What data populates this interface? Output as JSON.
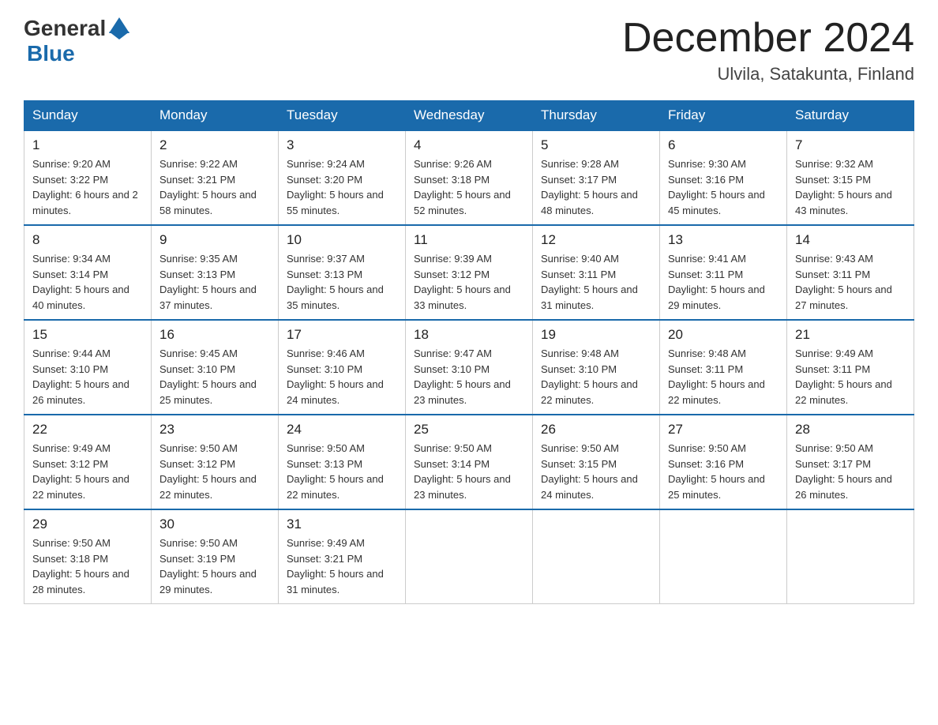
{
  "header": {
    "logo": {
      "general": "General",
      "blue": "Blue"
    },
    "title": "December 2024",
    "location": "Ulvila, Satakunta, Finland"
  },
  "calendar": {
    "days_of_week": [
      "Sunday",
      "Monday",
      "Tuesday",
      "Wednesday",
      "Thursday",
      "Friday",
      "Saturday"
    ],
    "weeks": [
      [
        {
          "day": "1",
          "sunrise": "Sunrise: 9:20 AM",
          "sunset": "Sunset: 3:22 PM",
          "daylight": "Daylight: 6 hours and 2 minutes."
        },
        {
          "day": "2",
          "sunrise": "Sunrise: 9:22 AM",
          "sunset": "Sunset: 3:21 PM",
          "daylight": "Daylight: 5 hours and 58 minutes."
        },
        {
          "day": "3",
          "sunrise": "Sunrise: 9:24 AM",
          "sunset": "Sunset: 3:20 PM",
          "daylight": "Daylight: 5 hours and 55 minutes."
        },
        {
          "day": "4",
          "sunrise": "Sunrise: 9:26 AM",
          "sunset": "Sunset: 3:18 PM",
          "daylight": "Daylight: 5 hours and 52 minutes."
        },
        {
          "day": "5",
          "sunrise": "Sunrise: 9:28 AM",
          "sunset": "Sunset: 3:17 PM",
          "daylight": "Daylight: 5 hours and 48 minutes."
        },
        {
          "day": "6",
          "sunrise": "Sunrise: 9:30 AM",
          "sunset": "Sunset: 3:16 PM",
          "daylight": "Daylight: 5 hours and 45 minutes."
        },
        {
          "day": "7",
          "sunrise": "Sunrise: 9:32 AM",
          "sunset": "Sunset: 3:15 PM",
          "daylight": "Daylight: 5 hours and 43 minutes."
        }
      ],
      [
        {
          "day": "8",
          "sunrise": "Sunrise: 9:34 AM",
          "sunset": "Sunset: 3:14 PM",
          "daylight": "Daylight: 5 hours and 40 minutes."
        },
        {
          "day": "9",
          "sunrise": "Sunrise: 9:35 AM",
          "sunset": "Sunset: 3:13 PM",
          "daylight": "Daylight: 5 hours and 37 minutes."
        },
        {
          "day": "10",
          "sunrise": "Sunrise: 9:37 AM",
          "sunset": "Sunset: 3:13 PM",
          "daylight": "Daylight: 5 hours and 35 minutes."
        },
        {
          "day": "11",
          "sunrise": "Sunrise: 9:39 AM",
          "sunset": "Sunset: 3:12 PM",
          "daylight": "Daylight: 5 hours and 33 minutes."
        },
        {
          "day": "12",
          "sunrise": "Sunrise: 9:40 AM",
          "sunset": "Sunset: 3:11 PM",
          "daylight": "Daylight: 5 hours and 31 minutes."
        },
        {
          "day": "13",
          "sunrise": "Sunrise: 9:41 AM",
          "sunset": "Sunset: 3:11 PM",
          "daylight": "Daylight: 5 hours and 29 minutes."
        },
        {
          "day": "14",
          "sunrise": "Sunrise: 9:43 AM",
          "sunset": "Sunset: 3:11 PM",
          "daylight": "Daylight: 5 hours and 27 minutes."
        }
      ],
      [
        {
          "day": "15",
          "sunrise": "Sunrise: 9:44 AM",
          "sunset": "Sunset: 3:10 PM",
          "daylight": "Daylight: 5 hours and 26 minutes."
        },
        {
          "day": "16",
          "sunrise": "Sunrise: 9:45 AM",
          "sunset": "Sunset: 3:10 PM",
          "daylight": "Daylight: 5 hours and 25 minutes."
        },
        {
          "day": "17",
          "sunrise": "Sunrise: 9:46 AM",
          "sunset": "Sunset: 3:10 PM",
          "daylight": "Daylight: 5 hours and 24 minutes."
        },
        {
          "day": "18",
          "sunrise": "Sunrise: 9:47 AM",
          "sunset": "Sunset: 3:10 PM",
          "daylight": "Daylight: 5 hours and 23 minutes."
        },
        {
          "day": "19",
          "sunrise": "Sunrise: 9:48 AM",
          "sunset": "Sunset: 3:10 PM",
          "daylight": "Daylight: 5 hours and 22 minutes."
        },
        {
          "day": "20",
          "sunrise": "Sunrise: 9:48 AM",
          "sunset": "Sunset: 3:11 PM",
          "daylight": "Daylight: 5 hours and 22 minutes."
        },
        {
          "day": "21",
          "sunrise": "Sunrise: 9:49 AM",
          "sunset": "Sunset: 3:11 PM",
          "daylight": "Daylight: 5 hours and 22 minutes."
        }
      ],
      [
        {
          "day": "22",
          "sunrise": "Sunrise: 9:49 AM",
          "sunset": "Sunset: 3:12 PM",
          "daylight": "Daylight: 5 hours and 22 minutes."
        },
        {
          "day": "23",
          "sunrise": "Sunrise: 9:50 AM",
          "sunset": "Sunset: 3:12 PM",
          "daylight": "Daylight: 5 hours and 22 minutes."
        },
        {
          "day": "24",
          "sunrise": "Sunrise: 9:50 AM",
          "sunset": "Sunset: 3:13 PM",
          "daylight": "Daylight: 5 hours and 22 minutes."
        },
        {
          "day": "25",
          "sunrise": "Sunrise: 9:50 AM",
          "sunset": "Sunset: 3:14 PM",
          "daylight": "Daylight: 5 hours and 23 minutes."
        },
        {
          "day": "26",
          "sunrise": "Sunrise: 9:50 AM",
          "sunset": "Sunset: 3:15 PM",
          "daylight": "Daylight: 5 hours and 24 minutes."
        },
        {
          "day": "27",
          "sunrise": "Sunrise: 9:50 AM",
          "sunset": "Sunset: 3:16 PM",
          "daylight": "Daylight: 5 hours and 25 minutes."
        },
        {
          "day": "28",
          "sunrise": "Sunrise: 9:50 AM",
          "sunset": "Sunset: 3:17 PM",
          "daylight": "Daylight: 5 hours and 26 minutes."
        }
      ],
      [
        {
          "day": "29",
          "sunrise": "Sunrise: 9:50 AM",
          "sunset": "Sunset: 3:18 PM",
          "daylight": "Daylight: 5 hours and 28 minutes."
        },
        {
          "day": "30",
          "sunrise": "Sunrise: 9:50 AM",
          "sunset": "Sunset: 3:19 PM",
          "daylight": "Daylight: 5 hours and 29 minutes."
        },
        {
          "day": "31",
          "sunrise": "Sunrise: 9:49 AM",
          "sunset": "Sunset: 3:21 PM",
          "daylight": "Daylight: 5 hours and 31 minutes."
        },
        null,
        null,
        null,
        null
      ]
    ]
  }
}
